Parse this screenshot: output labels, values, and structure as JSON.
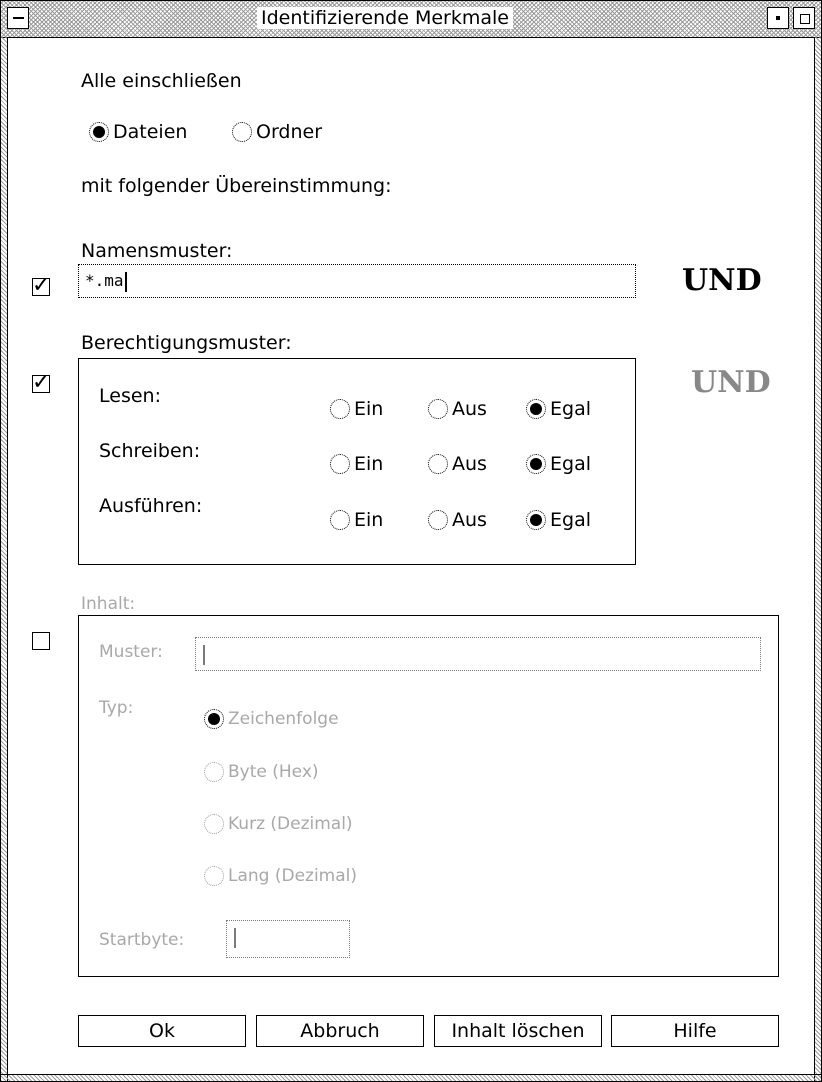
{
  "window": {
    "title": "Identifizierende Merkmale"
  },
  "include": {
    "heading": "Alle einschließen",
    "options": [
      {
        "label": "Dateien",
        "selected": true
      },
      {
        "label": "Ordner",
        "selected": false
      }
    ],
    "match_label": "mit folgender Übereinstimmung:"
  },
  "name_pattern": {
    "label": "Namensmuster:",
    "enabled": true,
    "value": "*.ma"
  },
  "connector": {
    "and_label": "UND"
  },
  "permissions": {
    "label": "Berechtigungsmuster:",
    "enabled": true,
    "rows": [
      {
        "label": "Lesen:",
        "options": [
          "Ein",
          "Aus",
          "Egal"
        ],
        "selected": "Egal"
      },
      {
        "label": "Schreiben:",
        "options": [
          "Ein",
          "Aus",
          "Egal"
        ],
        "selected": "Egal"
      },
      {
        "label": "Ausführen:",
        "options": [
          "Ein",
          "Aus",
          "Egal"
        ],
        "selected": "Egal"
      }
    ]
  },
  "content": {
    "label": "Inhalt:",
    "enabled": false,
    "pattern_label": "Muster:",
    "pattern_value": "",
    "type_label": "Typ:",
    "types": [
      {
        "label": "Zeichenfolge",
        "selected": true
      },
      {
        "label": "Byte (Hex)",
        "selected": false
      },
      {
        "label": "Kurz (Dezimal)",
        "selected": false
      },
      {
        "label": "Lang (Dezimal)",
        "selected": false
      }
    ],
    "start_byte_label": "Startbyte:",
    "start_byte_value": ""
  },
  "buttons": {
    "ok": "Ok",
    "cancel": "Abbruch",
    "clear": "Inhalt löschen",
    "help": "Hilfe"
  }
}
